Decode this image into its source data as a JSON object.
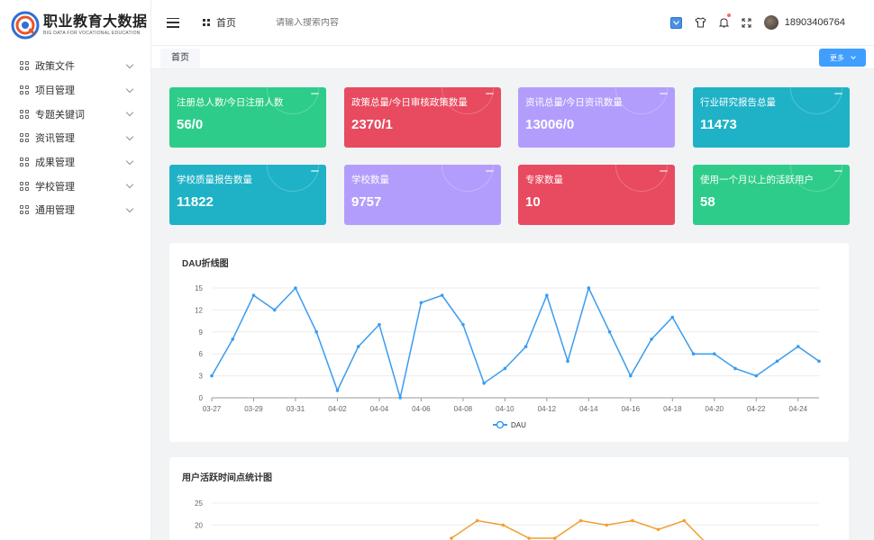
{
  "sidebar": {
    "logo_title": "职业教育大数据",
    "logo_subtitle": "BIG DATA FOR VOCATIONAL EDUCATION",
    "items": [
      {
        "label": "政策文件",
        "name": "sidebar-item-policy-documents"
      },
      {
        "label": "项目管理",
        "name": "sidebar-item-project-management"
      },
      {
        "label": "专题关键词",
        "name": "sidebar-item-topic-keywords"
      },
      {
        "label": "资讯管理",
        "name": "sidebar-item-news-management"
      },
      {
        "label": "成果管理",
        "name": "sidebar-item-achievement-management"
      },
      {
        "label": "学校管理",
        "name": "sidebar-item-school-management"
      },
      {
        "label": "通用管理",
        "name": "sidebar-item-general-management"
      }
    ]
  },
  "header": {
    "breadcrumb": "首页",
    "search_placeholder": "请输入搜索内容",
    "username": "18903406764",
    "icons": [
      "size-select-icon",
      "shirt-theme-icon",
      "bell-icon",
      "fullscreen-icon",
      "avatar"
    ]
  },
  "tabs": {
    "home_label": "首页",
    "more_label": "更多"
  },
  "colors": {
    "green": "#2ecc8a",
    "red": "#e84a5f",
    "purple": "#b39dfc",
    "teal": "#1fb2c6",
    "line_blue": "#3a9cf0",
    "line_orange": "#f0a030"
  },
  "cards": [
    {
      "title": "注册总人数/今日注册人数",
      "value": "56/0",
      "color": "#2ecc8a"
    },
    {
      "title": "政策总量/今日审核政策数量",
      "value": "2370/1",
      "color": "#e84a5f"
    },
    {
      "title": "资讯总量/今日资讯数量",
      "value": "13006/0",
      "color": "#b39dfc"
    },
    {
      "title": "行业研究报告总量",
      "value": "11473",
      "color": "#1fb2c6"
    },
    {
      "title": "学校质量报告数量",
      "value": "11822",
      "color": "#1fb2c6"
    },
    {
      "title": "学校数量",
      "value": "9757",
      "color": "#b39dfc"
    },
    {
      "title": "专家数量",
      "value": "10",
      "color": "#e84a5f"
    },
    {
      "title": "使用一个月以上的活跃用户",
      "value": "58",
      "color": "#2ecc8a"
    }
  ],
  "dau_panel_title": "DAU折线图",
  "activity_panel_title": "用户活跃时间点统计图",
  "chart_data": [
    {
      "type": "line",
      "title": "DAU折线图",
      "xlabel": "",
      "ylabel": "",
      "ylim": [
        0,
        15
      ],
      "yticks": [
        0,
        3,
        6,
        9,
        12,
        15
      ],
      "grid": true,
      "legend": "bottom",
      "x_tick_labels": [
        "03-27",
        "03-29",
        "03-31",
        "04-02",
        "04-04",
        "04-06",
        "04-08",
        "04-10",
        "04-12",
        "04-14",
        "04-16",
        "04-18",
        "04-20",
        "04-22",
        "04-24"
      ],
      "x": [
        "03-27",
        "03-28",
        "03-29",
        "03-30",
        "03-31",
        "04-01",
        "04-02",
        "04-03",
        "04-04",
        "04-05",
        "04-06",
        "04-07",
        "04-08",
        "04-09",
        "04-10",
        "04-11",
        "04-12",
        "04-13",
        "04-14",
        "04-15",
        "04-16",
        "04-17",
        "04-18",
        "04-19",
        "04-20",
        "04-21",
        "04-22",
        "04-23",
        "04-24",
        "04-25"
      ],
      "series": [
        {
          "name": "DAU",
          "values": [
            3,
            8,
            14,
            12,
            15,
            9,
            1,
            7,
            10,
            0,
            13,
            14,
            10,
            2,
            4,
            7,
            14,
            5,
            15,
            9,
            3,
            8,
            11,
            6,
            6,
            4,
            3,
            5,
            7,
            5
          ]
        }
      ]
    },
    {
      "type": "line",
      "title": "用户活跃时间点统计图",
      "ylim": [
        0,
        25
      ],
      "yticks_visible": [
        20,
        25
      ],
      "grid": true,
      "partial": true,
      "series": [
        {
          "values": [
            17,
            21,
            20,
            17,
            17,
            21,
            20,
            21,
            19,
            21,
            15
          ]
        }
      ]
    }
  ]
}
